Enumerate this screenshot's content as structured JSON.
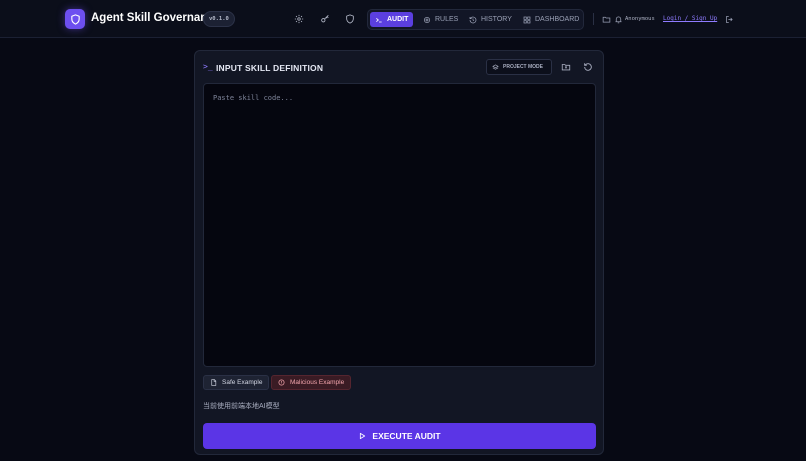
{
  "app": {
    "title": "Agent Skill Governance",
    "version": "v0.1.0"
  },
  "header_icons": [
    "settings-icon",
    "key-icon",
    "shield-icon"
  ],
  "nav": {
    "tabs": [
      {
        "label": "AUDIT",
        "icon": "terminal-icon",
        "active": true
      },
      {
        "label": "RULES",
        "icon": "gear-icon",
        "active": false
      },
      {
        "label": "HISTORY",
        "icon": "history-icon",
        "active": false
      },
      {
        "label": "DASHBOARD",
        "icon": "grid-icon",
        "active": false
      }
    ]
  },
  "user": {
    "name": "Anonymous",
    "login_link": "Login / Sign Up"
  },
  "panel": {
    "prompt_symbol": ">_",
    "title": "INPUT SKILL DEFINITION",
    "project_mode_label": "PROJECT MODE",
    "editor_placeholder": "Paste skill code...",
    "safe_example_label": "Safe Example",
    "malicious_example_label": "Malicious Example",
    "model_note": "当前使用前端本地AI模型",
    "execute_label": "EXECUTE AUDIT"
  },
  "colors": {
    "background": "#070914",
    "panel": "#121624",
    "accent": "#5b35e6",
    "link": "#8f7bff",
    "danger_text": "#f3a5ad"
  }
}
